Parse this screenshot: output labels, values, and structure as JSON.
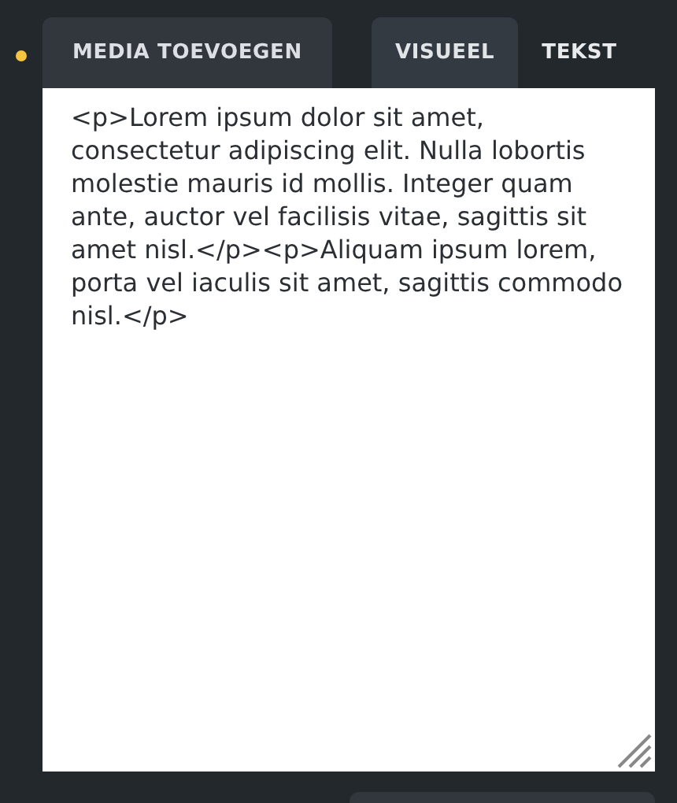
{
  "status_dot": {
    "color": "#f5c542"
  },
  "media_button": {
    "label": "MEDIA TOEVOEGEN"
  },
  "tabs": [
    {
      "label": "VISUEEL",
      "selected": true
    },
    {
      "label": "TEKST",
      "selected": false
    }
  ],
  "editor": {
    "value": "<p>Lorem ipsum dolor sit amet, consectetur adipiscing elit. Nulla lobortis molestie mauris id mollis. Integer quam ante, auctor vel facilisis vitae, sagittis sit amet nisl.</p><p>Aliquam ipsum lorem, porta vel iaculis sit amet, sagittis commodo nisl.</p>"
  }
}
